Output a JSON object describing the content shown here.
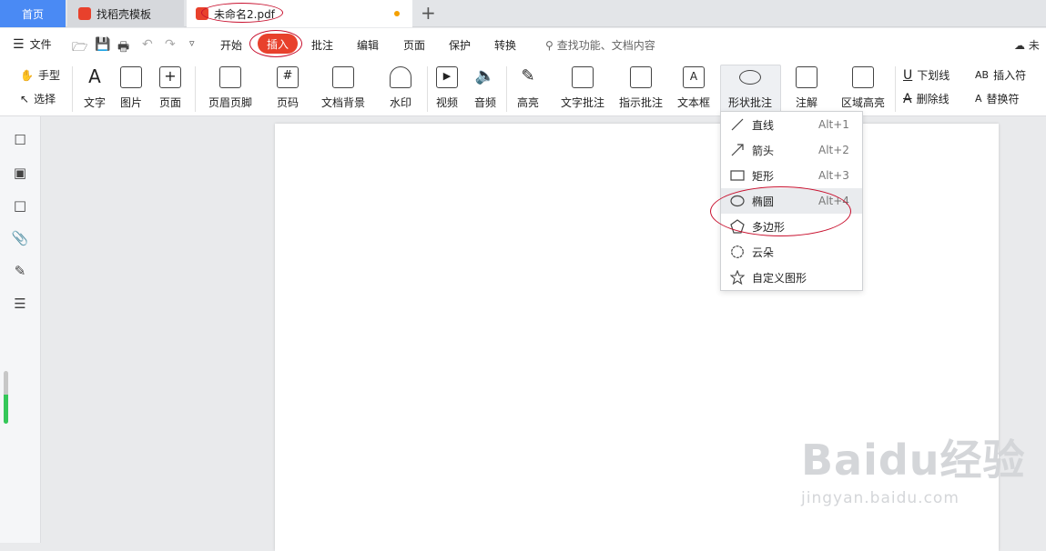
{
  "tabs": {
    "home": "首页",
    "template": "找稻壳模板",
    "document": "未命名2.pdf"
  },
  "menu": {
    "file": "文件",
    "items": [
      "开始",
      "插入",
      "批注",
      "编辑",
      "页面",
      "保护",
      "转换"
    ],
    "search_placeholder": "查找功能、文档内容",
    "cloud": "未"
  },
  "ribbon": {
    "hand": "手型",
    "select": "选择",
    "text": "文字",
    "image": "图片",
    "page": "页面",
    "header_footer": "页眉页脚",
    "page_number": "页码",
    "doc_background": "文档背景",
    "watermark": "水印",
    "video": "视频",
    "audio": "音频",
    "highlight": "高亮",
    "text_annotation": "文字批注",
    "pointer_annotation": "指示批注",
    "text_box": "文本框",
    "shape_annotation": "形状批注",
    "note": "注解",
    "area_highlight": "区域高亮",
    "underline": "下划线",
    "strikethrough": "删除线",
    "insert_mark": "插入符",
    "replace_mark": "替换符"
  },
  "shape_menu": [
    {
      "icon": "line-icon",
      "label": "直线",
      "shortcut": "Alt+1"
    },
    {
      "icon": "arrow-icon",
      "label": "箭头",
      "shortcut": "Alt+2"
    },
    {
      "icon": "rectangle-icon",
      "label": "矩形",
      "shortcut": "Alt+3"
    },
    {
      "icon": "ellipse-icon",
      "label": "椭圆",
      "shortcut": "Alt+4"
    },
    {
      "icon": "polygon-icon",
      "label": "多边形",
      "shortcut": ""
    },
    {
      "icon": "cloud-icon",
      "label": "云朵",
      "shortcut": ""
    },
    {
      "icon": "star-icon",
      "label": "自定义图形",
      "shortcut": ""
    }
  ],
  "watermark": {
    "logo": "Baidu经验",
    "url": "jingyan.baidu.com"
  },
  "colors": {
    "accent": "#e8412c",
    "home_tab": "#4a8af4",
    "annotation_ring": "#c8102e"
  }
}
